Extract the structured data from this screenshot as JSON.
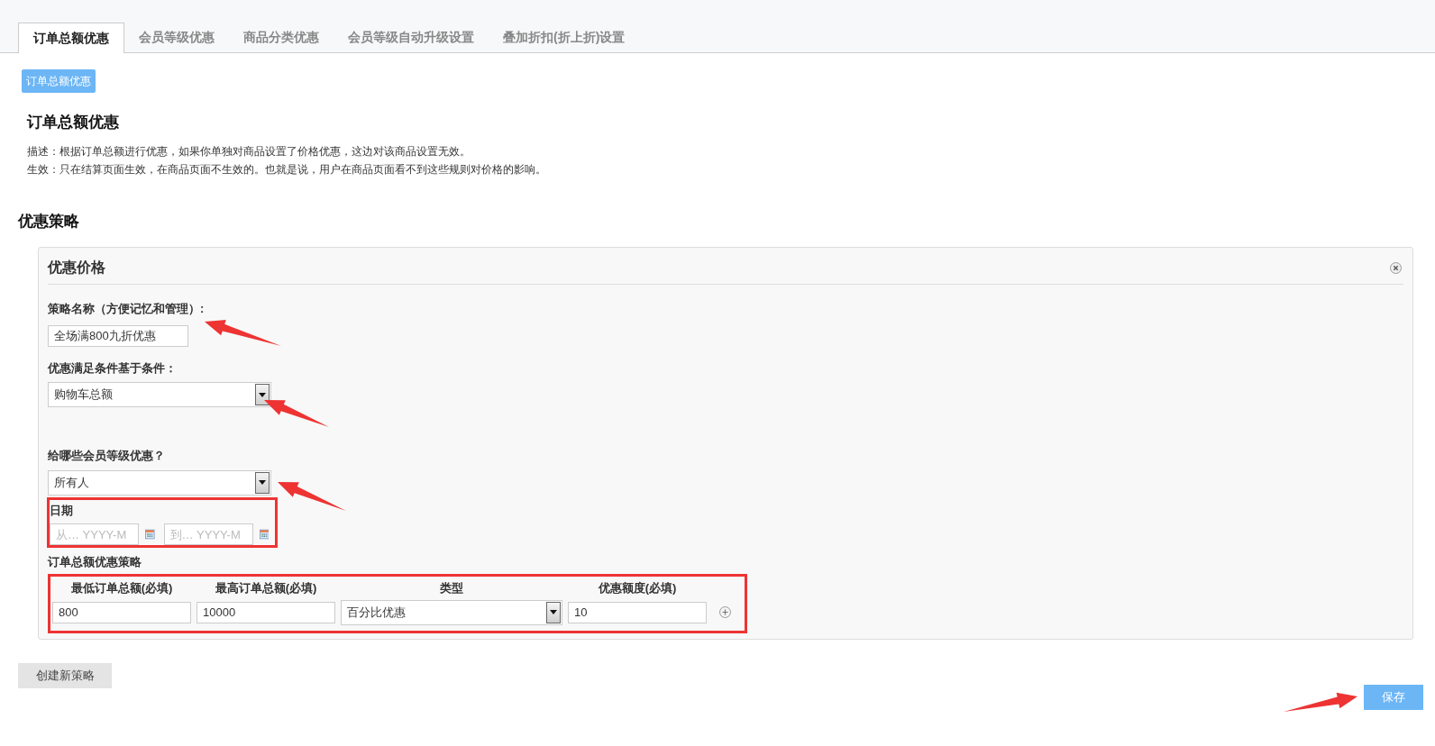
{
  "tabs": [
    {
      "label": "订单总额优惠",
      "selected": true
    },
    {
      "label": "会员等级优惠",
      "selected": false
    },
    {
      "label": "商品分类优惠",
      "selected": false
    },
    {
      "label": "会员等级自动升级设置",
      "selected": false
    },
    {
      "label": "叠加折扣(折上折)设置",
      "selected": false
    }
  ],
  "badge": "订单总额优惠",
  "heading": "订单总额优惠",
  "description": [
    "描述：根据订单总额进行优惠，如果你单独对商品设置了价格优惠，这边对该商品设置无效。",
    "生效：只在结算页面生效，在商品页面不生效的。也就是说，用户在商品页面看不到这些规则对价格的影响。"
  ],
  "section_title": "优惠策略",
  "panel": {
    "title": "优惠价格",
    "name_label": "策略名称（方便记忆和管理）:",
    "name_value": "全场满800九折优惠",
    "condition_label": "优惠满足条件基于条件：",
    "condition_value": "购物车总额",
    "members_label": "给哪些会员等级优惠？",
    "members_value": "所有人",
    "date_label": "日期",
    "date_from_placeholder": "从… YYYY-M",
    "date_to_placeholder": "到… YYYY-M",
    "strategy_label": "订单总额优惠策略",
    "columns": [
      "最低订单总额(必填)",
      "最高订单总额(必填)",
      "类型",
      "优惠额度(必填)"
    ],
    "rows": [
      {
        "min": "800",
        "max": "10000",
        "type": "百分比优惠",
        "amount": "10"
      }
    ]
  },
  "create_button": "创建新策略",
  "save_button": "保存"
}
